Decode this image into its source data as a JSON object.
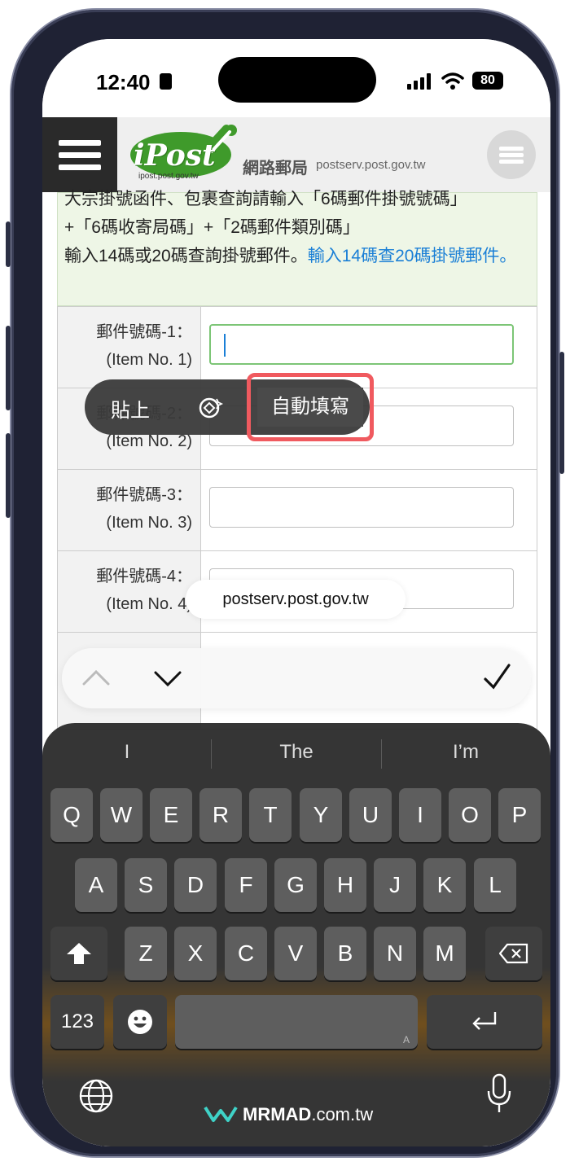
{
  "status_bar": {
    "time": "12:40",
    "battery": "80"
  },
  "header": {
    "logo_text": "iPost",
    "logo_url": "ipost.post.gov.tw",
    "site_name": "網路郵局",
    "site_domain": "postserv.post.gov.tw"
  },
  "info": {
    "line1": "大宗掛號函件、包裹查詢請輸入「6碼郵件掛號號碼」",
    "line2": "+「6碼收寄局碼」+「2碼郵件類別碼」",
    "line3_text": "輸入14碼或20碼查詢掛號郵件。",
    "line3_link": "輸入14碼查20碼掛號郵件。"
  },
  "rows": [
    {
      "label": "郵件號碼-1：",
      "sub": "(Item No. 1)"
    },
    {
      "label": "郵件號碼-2：",
      "sub": "(Item No. 2)"
    },
    {
      "label": "郵件號碼-3：",
      "sub": "(Item No. 3)"
    },
    {
      "label": "郵件號碼-4：",
      "sub": "(Item No. 4)"
    }
  ],
  "context_menu": {
    "paste": "貼上",
    "ai_icon": "sparkle-icon",
    "autofill": "自動填寫",
    "highlight_color": "#f05a5f"
  },
  "domain_pill": "postserv.post.gov.tw",
  "keyboard": {
    "suggestions": [
      "I",
      "The",
      "I’m"
    ],
    "row1": [
      "Q",
      "W",
      "E",
      "R",
      "T",
      "Y",
      "U",
      "I",
      "O",
      "P"
    ],
    "row2": [
      "A",
      "S",
      "D",
      "F",
      "G",
      "H",
      "J",
      "K",
      "L"
    ],
    "row3": [
      "Z",
      "X",
      "C",
      "V",
      "B",
      "N",
      "M"
    ],
    "numbers_key": "123",
    "space_hint": "A"
  },
  "watermark": {
    "brand": "MRMAD",
    "suffix": ".com.tw"
  }
}
